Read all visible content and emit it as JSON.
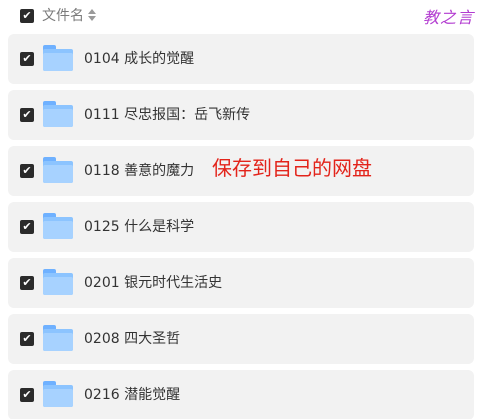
{
  "header": {
    "column_label": "文件名",
    "select_all_checked": "✔",
    "sort_icon": "sort-arrows-icon",
    "brand": "教之言"
  },
  "files": [
    {
      "name": "0104 成长的觉醒",
      "check": "✔",
      "icon": "folder-icon"
    },
    {
      "name": "0111 尽忠报国：岳飞新传",
      "check": "✔",
      "icon": "folder-icon"
    },
    {
      "name": "0118 善意的魔力",
      "check": "✔",
      "icon": "folder-icon"
    },
    {
      "name": "0125 什么是科学",
      "check": "✔",
      "icon": "folder-icon"
    },
    {
      "name": "0201 银元时代生活史",
      "check": "✔",
      "icon": "folder-icon"
    },
    {
      "name": "0208 四大圣哲",
      "check": "✔",
      "icon": "folder-icon"
    },
    {
      "name": "0216 潜能觉醒",
      "check": "✔",
      "icon": "folder-icon"
    }
  ],
  "annotation": "保存到自己的网盘",
  "colors": {
    "row_background": "#f2f2f2",
    "folder": "#8cc4ff",
    "annotation": "#e3241b",
    "brand": "#b23bd0",
    "checkbox": "#2b2b2b"
  }
}
